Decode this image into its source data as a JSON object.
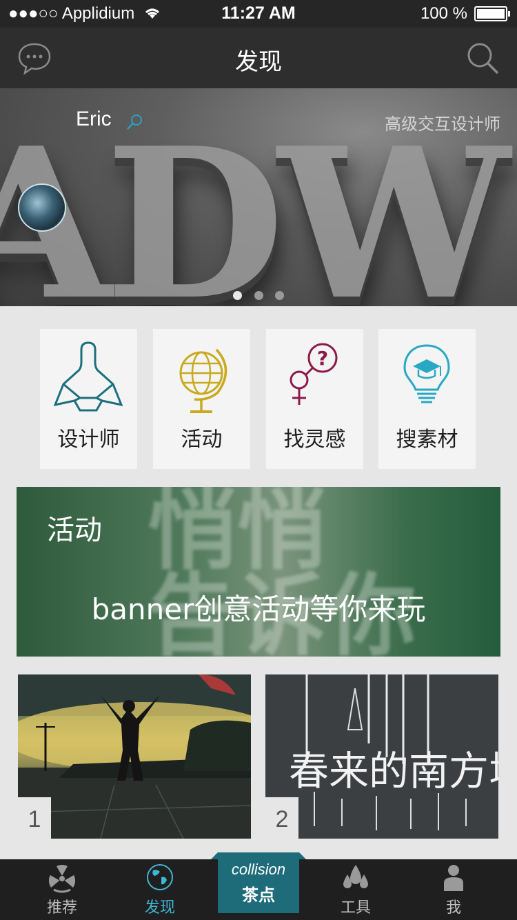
{
  "status": {
    "carrier": "●●●○○ Applidium",
    "time": "11:27 AM",
    "battery": "100 %"
  },
  "nav": {
    "title": "发现",
    "left_icon": "chat-bubble-icon",
    "right_icon": "search-icon"
  },
  "hero": {
    "user_name": "Eric",
    "user_role": "高级交互设计师",
    "page_count": 3,
    "active_page": 1
  },
  "categories": [
    {
      "label": "设计师",
      "icon": "designer-icon",
      "color": "#1b6f7c"
    },
    {
      "label": "活动",
      "icon": "globe-icon",
      "color": "#c9a91e"
    },
    {
      "label": "找灵感",
      "icon": "gender-question-icon",
      "color": "#8b1a4a"
    },
    {
      "label": "搜素材",
      "icon": "lightbulb-graduation-icon",
      "color": "#27a8c4"
    }
  ],
  "banner": {
    "tag": "活动",
    "headline": "banner创意活动等你来玩"
  },
  "cards": [
    {
      "number": "1"
    },
    {
      "number": "2"
    }
  ],
  "tabbar": {
    "items": [
      {
        "label": "推荐",
        "icon": "radiation-icon"
      },
      {
        "label": "发现",
        "icon": "globe-icon"
      },
      {
        "label": "工具",
        "icon": "drops-icon"
      },
      {
        "label": "我",
        "icon": "person-icon"
      }
    ],
    "center": {
      "title_en": "collision",
      "title_zh": "茶点"
    },
    "accent": "#3fb6d8"
  }
}
